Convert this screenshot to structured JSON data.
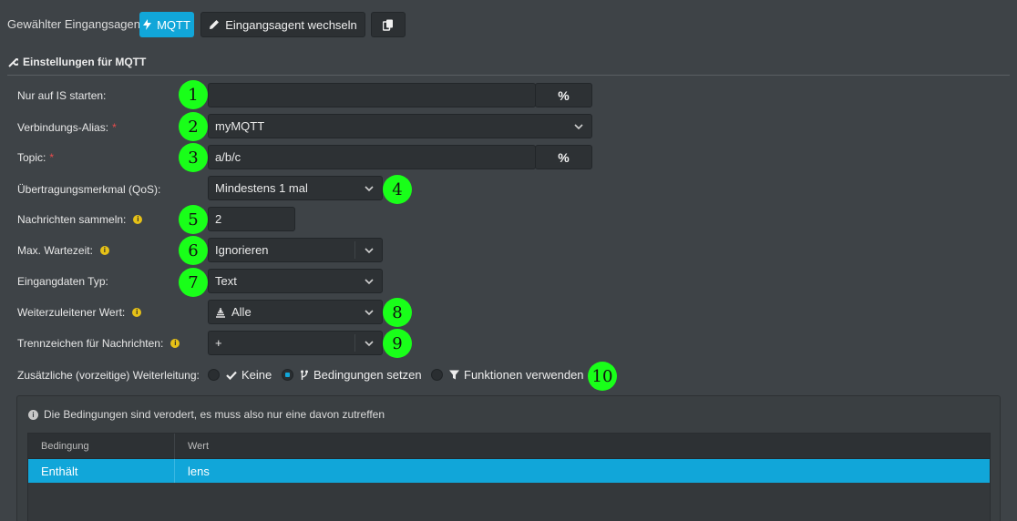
{
  "header": {
    "agent_label": "Gewählter Eingangsagent:",
    "agent_button": "MQTT",
    "switch_button": "Eingangsagent wechseln"
  },
  "section": {
    "title": "Einstellungen für MQTT"
  },
  "form": {
    "is_start": {
      "label": "Nur auf IS starten:",
      "value": "",
      "pct": "%"
    },
    "alias": {
      "label": "Verbindungs-Alias:",
      "required": "*",
      "value": "myMQTT"
    },
    "topic": {
      "label": "Topic:",
      "required": "*",
      "value": "a/b/c",
      "pct": "%"
    },
    "qos": {
      "label": "Übertragungsmerkmal (QoS):",
      "value": "Mindestens 1 mal"
    },
    "collect": {
      "label": "Nachrichten sammeln:",
      "value": "2"
    },
    "wait": {
      "label": "Max. Wartezeit:",
      "value": "Ignorieren"
    },
    "input_type": {
      "label": "Eingangdaten Typ:",
      "value": "Text"
    },
    "forward_value": {
      "label": "Weiterzuleitener Wert:",
      "value": "Alle"
    },
    "separator": {
      "label": "Trennzeichen für Nachrichten:",
      "value": "+"
    },
    "early_forward": {
      "label": "Zusätzliche (vorzeitige) Weiterleitung:",
      "options": [
        "Keine",
        "Bedingungen setzen",
        "Funktionen verwenden"
      ],
      "selected": "Bedingungen setzen"
    }
  },
  "badges": [
    "1",
    "2",
    "3",
    "4",
    "5",
    "6",
    "7",
    "8",
    "9",
    "10"
  ],
  "conditions": {
    "info": "Die Bedingungen sind verodert, es muss also nur eine davon zutreffen",
    "columns": [
      "Bedingung",
      "Wert"
    ],
    "rows": [
      {
        "condition": "Enthält",
        "value": "lens"
      }
    ]
  },
  "colors": {
    "accent": "#11a6d9",
    "badge": "#19ff19",
    "required": "#e84c4c",
    "info": "#e6c117"
  }
}
